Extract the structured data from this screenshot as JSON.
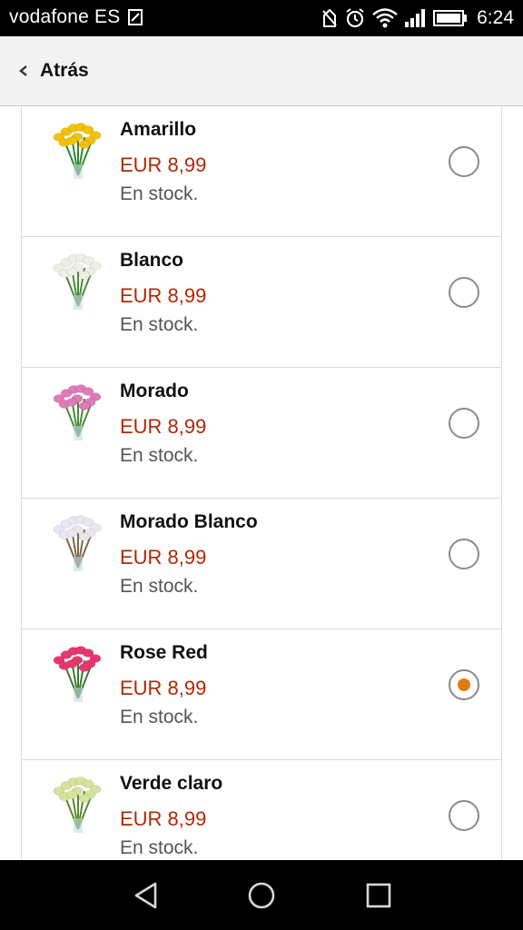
{
  "status_bar": {
    "carrier": "vodafone ES",
    "time": "6:24"
  },
  "header": {
    "back_label": "Atrás"
  },
  "items": [
    {
      "name": "Amarillo",
      "price": "EUR 8,99",
      "stock": "En stock.",
      "selected": false,
      "flower_color": "#f2c200",
      "stem_color": "#2f8a2f"
    },
    {
      "name": "Blanco",
      "price": "EUR 8,99",
      "stock": "En stock.",
      "selected": false,
      "flower_color": "#eef0e6",
      "stem_color": "#4b8a3a"
    },
    {
      "name": "Morado",
      "price": "EUR 8,99",
      "stock": "En stock.",
      "selected": false,
      "flower_color": "#e07ab8",
      "stem_color": "#4a8a3a"
    },
    {
      "name": "Morado Blanco",
      "price": "EUR 8,99",
      "stock": "En stock.",
      "selected": false,
      "flower_color": "#e9e6f0",
      "stem_color": "#7a6a4a"
    },
    {
      "name": "Rose Red",
      "price": "EUR 8,99",
      "stock": "En stock.",
      "selected": true,
      "flower_color": "#e8366e",
      "stem_color": "#3d7a2e"
    },
    {
      "name": "Verde claro",
      "price": "EUR 8,99",
      "stock": "En stock.",
      "selected": false,
      "flower_color": "#d6e39a",
      "stem_color": "#5a8a2e"
    }
  ],
  "colors": {
    "price": "#b12704",
    "radio_selected": "#e47911"
  }
}
